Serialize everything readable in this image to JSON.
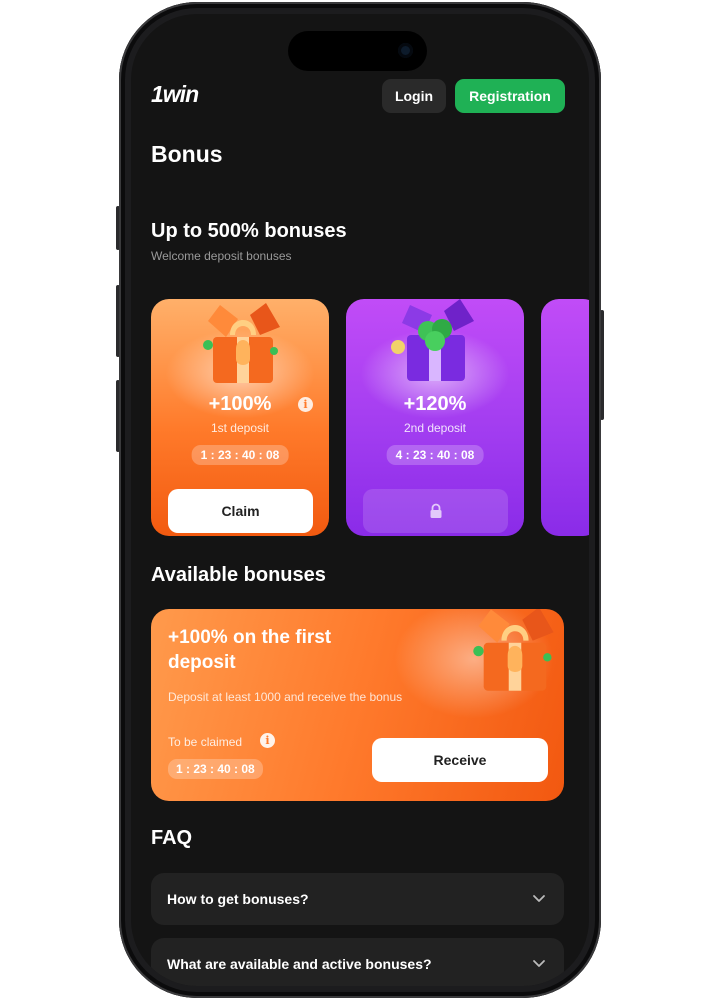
{
  "header": {
    "logo": "1win",
    "login_label": "Login",
    "registration_label": "Registration"
  },
  "page_title": "Bonus",
  "welcome": {
    "title": "Up to 500% bonuses",
    "subtitle": "Welcome deposit bonuses",
    "cards": [
      {
        "percent": "+100%",
        "deposit": "1st deposit",
        "timer": "1 : 23 : 40 : 08",
        "button": "Claim",
        "locked": false
      },
      {
        "percent": "+120%",
        "deposit": "2nd deposit",
        "timer": "4 : 23 : 40 : 08",
        "button": "",
        "locked": true
      }
    ]
  },
  "available": {
    "section_title": "Available bonuses",
    "card": {
      "title": "+100% on the first deposit",
      "description": "Deposit at least 1000   and receive the bonus",
      "claimed_label": "To be claimed",
      "timer": "1 : 23 : 40 : 08",
      "button": "Receive"
    }
  },
  "faq": {
    "title": "FAQ",
    "items": [
      {
        "question": "How to get bonuses?"
      },
      {
        "question": "What are available and active bonuses?"
      }
    ]
  },
  "colors": {
    "background": "#141414",
    "accent_green": "#1fb155",
    "orange": "#ff7a2a",
    "purple": "#a23df0"
  }
}
